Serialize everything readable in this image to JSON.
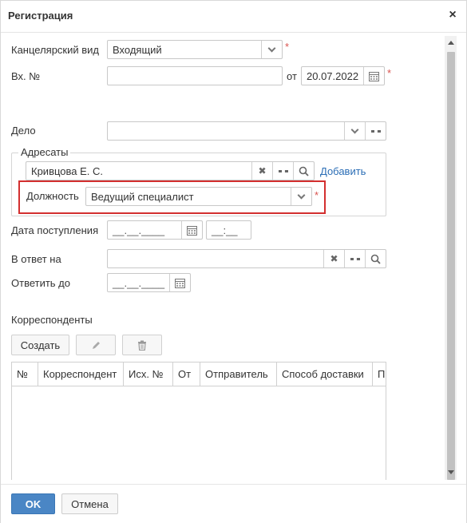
{
  "dialog": {
    "title": "Регистрация",
    "close": "×"
  },
  "form": {
    "office_type": {
      "label": "Канцелярский вид",
      "value": "Входящий",
      "required": "*"
    },
    "incoming_no": {
      "label": "Вх. №",
      "value": "",
      "from_label": "от",
      "date": "20.07.2022",
      "required": "*"
    },
    "case": {
      "label": "Дело",
      "value": ""
    },
    "addressees": {
      "legend": "Адресаты",
      "name": "Кривцова Е. С.",
      "add_link": "Добавить",
      "position_label": "Должность",
      "position_value": "Ведущий специалист",
      "required": "*"
    },
    "receipt_date": {
      "label": "Дата поступления",
      "date_mask": "__.__.____",
      "time_mask": "__:__"
    },
    "reply_to": {
      "label": "В ответ на",
      "value": ""
    },
    "reply_until": {
      "label": "Ответить до",
      "date_mask": "__.__.____"
    },
    "correspondents": {
      "title": "Корреспонденты",
      "create_label": "Создать",
      "columns": [
        "№",
        "Корреспондент",
        "Исх. №",
        "От",
        "Отправитель",
        "Способ доставки",
        "П"
      ]
    }
  },
  "footer": {
    "ok": "OK",
    "cancel": "Отмена"
  },
  "colors": {
    "accent": "#4a86c5",
    "required": "#d9534f",
    "highlight": "#d32f2f",
    "link": "#2a6db5"
  }
}
